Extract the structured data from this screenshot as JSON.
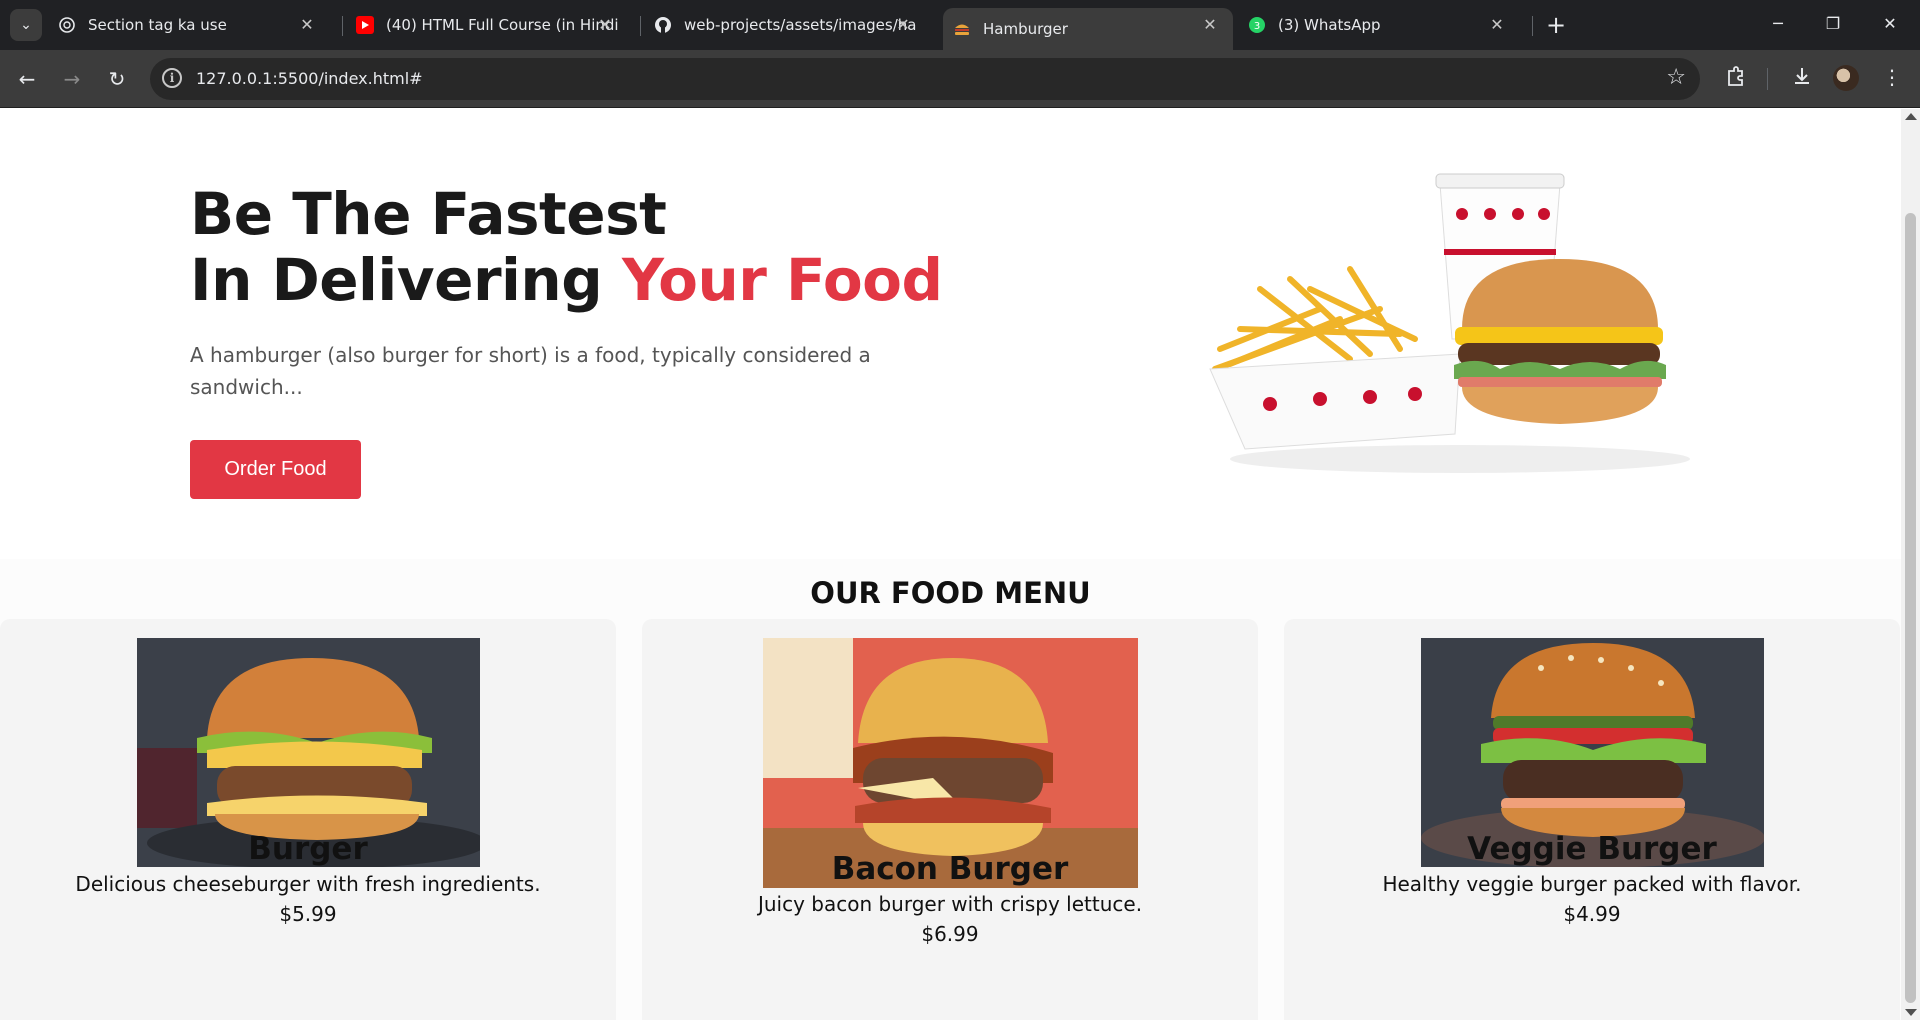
{
  "browser": {
    "tabs": [
      {
        "title": "Section tag ka use",
        "icon": "chatgpt-icon"
      },
      {
        "title": "(40) HTML Full Course (in Hindi",
        "icon": "youtube-icon"
      },
      {
        "title": "web-projects/assets/images/ha",
        "icon": "github-icon"
      },
      {
        "title": "Hamburger",
        "icon": "hamburger-favicon-icon",
        "active": true
      },
      {
        "title": "(3) WhatsApp",
        "icon": "whatsapp-icon",
        "badge": "3"
      }
    ],
    "url": "127.0.0.1:5500/index.html#"
  },
  "hero": {
    "title_line1": "Be The Fastest",
    "title_line2_plain": "In Delivering ",
    "title_line2_accent": "Your Food",
    "description": "A hamburger (also burger for short) is a food, typically considered a sandwich...",
    "button_label": "Order Food",
    "accent_color": "#e23744"
  },
  "menu": {
    "title": "OUR FOOD MENU",
    "items": [
      {
        "name": "Burger",
        "description": "Delicious cheeseburger with fresh ingredients.",
        "price": "$5.99"
      },
      {
        "name": "Bacon Burger",
        "description": "Juicy bacon burger with crispy lettuce.",
        "price": "$6.99"
      },
      {
        "name": "Veggie Burger",
        "description": "Healthy veggie burger packed with flavor.",
        "price": "$4.99"
      }
    ]
  }
}
